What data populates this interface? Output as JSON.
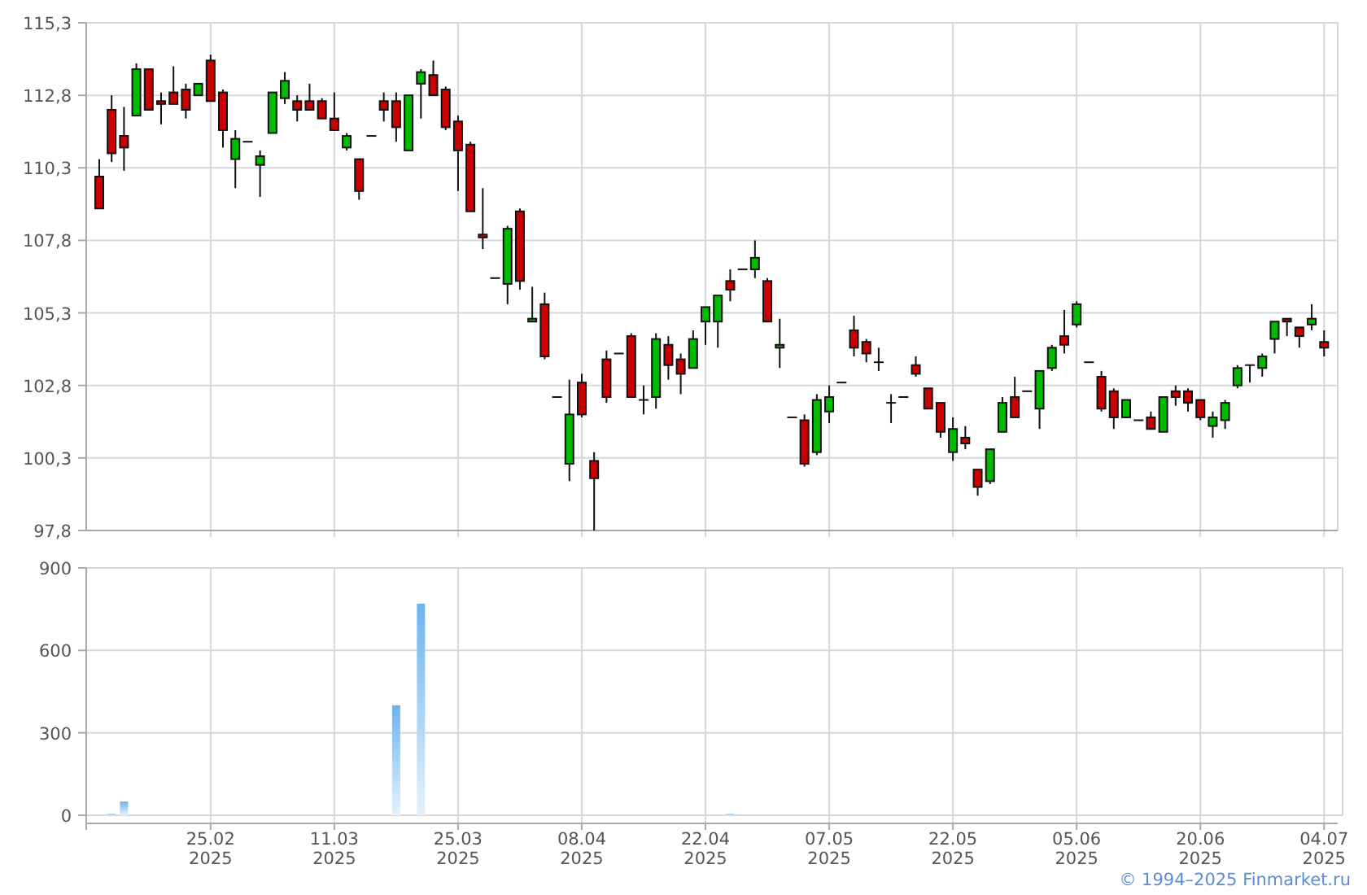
{
  "price_chart": {
    "chart_data": {
      "type": "candlestick",
      "ylim": [
        97.8,
        115.3
      ],
      "grid": true,
      "categories": [
        null,
        null,
        null,
        null,
        null,
        null,
        null,
        null,
        null,
        null,
        null,
        null,
        null,
        null,
        null,
        null,
        null,
        null,
        null,
        null,
        null,
        null,
        null,
        null,
        null,
        null,
        null,
        null,
        null,
        null,
        null,
        null,
        null,
        null,
        null,
        null,
        null,
        null,
        null,
        null,
        null,
        null,
        null,
        null,
        null,
        null,
        null,
        null,
        null,
        null,
        null,
        null,
        null,
        null,
        null,
        null,
        null,
        null,
        null,
        null,
        null,
        null,
        null,
        null,
        null,
        null,
        null,
        null,
        null,
        null,
        null,
        null,
        null,
        null,
        null,
        null,
        null,
        null,
        null,
        null,
        null,
        null,
        null,
        null,
        null,
        null,
        null,
        null,
        null,
        null,
        null,
        null,
        null,
        null,
        null,
        null,
        null,
        null,
        null,
        null
      ],
      "yticks": [
        {
          "value": 97.8,
          "label": "97,8"
        },
        {
          "value": 100.3,
          "label": "100,3"
        },
        {
          "value": 102.8,
          "label": "102,8"
        },
        {
          "value": 105.3,
          "label": "105,3"
        },
        {
          "value": 107.8,
          "label": "107,8"
        },
        {
          "value": 110.3,
          "label": "110,3"
        },
        {
          "value": 112.8,
          "label": "112,8"
        },
        {
          "value": 115.3,
          "label": "115,3"
        }
      ],
      "ohlc": [
        [
          110.0,
          110.6,
          108.9,
          108.9
        ],
        [
          112.3,
          112.8,
          110.5,
          110.8
        ],
        [
          111.4,
          112.4,
          110.2,
          111.0
        ],
        [
          112.1,
          113.9,
          112.1,
          113.7
        ],
        [
          113.7,
          113.7,
          112.3,
          112.3
        ],
        [
          112.6,
          112.9,
          111.8,
          112.5
        ],
        [
          112.9,
          113.8,
          112.5,
          112.5
        ],
        [
          113.0,
          113.2,
          112.0,
          112.3
        ],
        [
          112.8,
          113.2,
          112.8,
          113.2
        ],
        [
          114.0,
          114.2,
          112.6,
          112.6
        ],
        [
          112.9,
          113.0,
          111.0,
          111.6
        ],
        [
          110.6,
          111.6,
          109.6,
          111.3
        ],
        [
          111.2,
          111.2,
          111.2,
          111.2
        ],
        [
          110.4,
          110.9,
          109.3,
          110.7
        ],
        [
          111.5,
          112.9,
          111.5,
          112.9
        ],
        [
          112.7,
          113.6,
          112.5,
          113.3
        ],
        [
          112.6,
          112.8,
          111.9,
          112.3
        ],
        [
          112.6,
          113.2,
          112.3,
          112.3
        ],
        [
          112.6,
          112.7,
          112.0,
          112.0
        ],
        [
          112.0,
          112.9,
          111.6,
          111.6
        ],
        [
          111.0,
          111.5,
          110.9,
          111.4
        ],
        [
          110.6,
          110.6,
          109.2,
          109.5
        ],
        [
          111.4,
          111.4,
          111.4,
          111.4
        ],
        [
          112.6,
          112.9,
          111.9,
          112.3
        ],
        [
          112.6,
          112.9,
          111.2,
          111.7
        ],
        [
          110.9,
          112.8,
          110.9,
          112.8
        ],
        [
          113.2,
          113.7,
          112.0,
          113.6
        ],
        [
          113.5,
          114.0,
          112.8,
          112.8
        ],
        [
          113.0,
          113.1,
          111.6,
          111.7
        ],
        [
          111.9,
          112.1,
          109.5,
          110.9
        ],
        [
          111.1,
          111.2,
          108.8,
          108.8
        ],
        [
          108.0,
          109.6,
          107.5,
          107.9
        ],
        [
          106.5,
          106.5,
          106.5,
          106.5
        ],
        [
          106.3,
          108.3,
          105.6,
          108.2
        ],
        [
          108.8,
          108.9,
          106.1,
          106.4
        ],
        [
          105.0,
          106.2,
          105.0,
          105.1
        ],
        [
          105.6,
          106.0,
          103.7,
          103.8
        ],
        [
          102.4,
          102.4,
          102.4,
          102.4
        ],
        [
          100.1,
          103.0,
          99.5,
          101.8
        ],
        [
          102.9,
          103.2,
          101.7,
          101.8
        ],
        [
          100.2,
          100.5,
          97.8,
          99.6
        ],
        [
          103.7,
          104.0,
          102.2,
          102.4
        ],
        [
          103.9,
          103.9,
          103.9,
          103.9
        ],
        [
          104.5,
          104.6,
          102.4,
          102.4
        ],
        [
          102.3,
          102.8,
          101.8,
          102.3
        ],
        [
          102.4,
          104.6,
          102.0,
          104.4
        ],
        [
          104.2,
          104.5,
          103.0,
          103.5
        ],
        [
          103.7,
          103.9,
          102.5,
          103.2
        ],
        [
          103.4,
          104.7,
          103.4,
          104.4
        ],
        [
          105.0,
          105.5,
          104.2,
          105.5
        ],
        [
          105.0,
          105.9,
          104.1,
          105.9
        ],
        [
          106.4,
          106.8,
          105.7,
          106.1
        ],
        [
          106.8,
          106.8,
          106.8,
          106.8
        ],
        [
          106.8,
          107.8,
          106.5,
          107.2
        ],
        [
          106.4,
          106.5,
          105.0,
          105.0
        ],
        [
          104.1,
          105.1,
          103.4,
          104.2
        ],
        [
          101.7,
          101.7,
          101.7,
          101.7
        ],
        [
          101.6,
          101.8,
          100.0,
          100.1
        ],
        [
          100.5,
          102.5,
          100.4,
          102.3
        ],
        [
          101.9,
          102.8,
          101.5,
          102.4
        ],
        [
          102.9,
          102.9,
          102.9,
          102.9
        ],
        [
          104.7,
          105.2,
          103.8,
          104.1
        ],
        [
          104.3,
          104.4,
          103.6,
          103.9
        ],
        [
          103.6,
          104.1,
          103.3,
          103.6
        ],
        [
          102.2,
          102.5,
          101.5,
          102.2
        ],
        [
          102.4,
          102.4,
          102.4,
          102.4
        ],
        [
          103.5,
          103.8,
          103.1,
          103.2
        ],
        [
          102.7,
          102.7,
          102.0,
          102.0
        ],
        [
          102.2,
          102.2,
          101.0,
          101.2
        ],
        [
          100.5,
          101.7,
          100.2,
          101.3
        ],
        [
          101.0,
          101.4,
          100.6,
          100.8
        ],
        [
          99.9,
          99.9,
          99.0,
          99.3
        ],
        [
          99.5,
          100.6,
          99.4,
          100.6
        ],
        [
          101.2,
          102.4,
          101.2,
          102.2
        ],
        [
          102.4,
          103.1,
          101.7,
          101.7
        ],
        [
          102.6,
          102.6,
          102.6,
          102.6
        ],
        [
          102.0,
          103.3,
          101.3,
          103.3
        ],
        [
          103.4,
          104.2,
          103.3,
          104.1
        ],
        [
          104.5,
          105.4,
          103.9,
          104.2
        ],
        [
          104.9,
          105.7,
          104.8,
          105.6
        ],
        [
          103.6,
          103.6,
          103.6,
          103.6
        ],
        [
          103.1,
          103.3,
          101.9,
          102.0
        ],
        [
          102.6,
          102.7,
          101.3,
          101.7
        ],
        [
          101.7,
          102.3,
          101.7,
          102.3
        ],
        [
          101.6,
          101.6,
          101.6,
          101.6
        ],
        [
          101.7,
          101.9,
          101.3,
          101.3
        ],
        [
          101.2,
          102.4,
          101.2,
          102.4
        ],
        [
          102.6,
          102.8,
          102.1,
          102.4
        ],
        [
          102.6,
          102.7,
          101.9,
          102.2
        ],
        [
          102.3,
          102.3,
          101.6,
          101.7
        ],
        [
          101.4,
          101.9,
          101.0,
          101.7
        ],
        [
          101.6,
          102.3,
          101.3,
          102.2
        ],
        [
          102.8,
          103.5,
          102.7,
          103.4
        ],
        [
          103.5,
          103.5,
          102.9,
          103.5
        ],
        [
          103.4,
          103.9,
          103.1,
          103.8
        ],
        [
          104.4,
          105.0,
          103.9,
          105.0
        ],
        [
          105.1,
          105.1,
          104.5,
          105.0
        ],
        [
          104.8,
          104.8,
          104.1,
          104.5
        ],
        [
          104.9,
          105.6,
          104.7,
          105.1
        ],
        [
          104.3,
          104.7,
          103.8,
          104.1
        ]
      ]
    }
  },
  "volume_chart": {
    "chart_data": {
      "type": "bar",
      "ylim": [
        0,
        900
      ],
      "grid": true,
      "categories": [
        null,
        null,
        null,
        null,
        null,
        null,
        null,
        null,
        null,
        "25.02\n2025",
        null,
        null,
        null,
        null,
        null,
        null,
        null,
        null,
        null,
        "11.03\n2025",
        null,
        null,
        null,
        null,
        null,
        null,
        null,
        null,
        null,
        "25.03\n2025",
        null,
        null,
        null,
        null,
        null,
        null,
        null,
        null,
        null,
        "08.04\n2025",
        null,
        null,
        null,
        null,
        null,
        null,
        null,
        null,
        null,
        "22.04\n2025",
        null,
        null,
        null,
        null,
        null,
        null,
        null,
        null,
        null,
        "07.05\n2025",
        null,
        null,
        null,
        null,
        null,
        null,
        null,
        null,
        null,
        "22.05\n2025",
        null,
        null,
        null,
        null,
        null,
        null,
        null,
        null,
        null,
        "05.06\n2025",
        null,
        null,
        null,
        null,
        null,
        null,
        null,
        null,
        null,
        "20.06\n2025",
        null,
        null,
        null,
        null,
        null,
        null,
        null,
        null,
        null,
        "04.07\n2025"
      ],
      "yticks": [
        0,
        300,
        600,
        900
      ],
      "values": [
        0,
        5,
        50,
        0,
        0,
        0,
        0,
        0,
        0,
        0,
        0,
        0,
        0,
        0,
        0,
        0,
        0,
        0,
        0,
        0,
        0,
        0,
        0,
        0,
        400,
        0,
        770,
        0,
        0,
        0,
        0,
        0,
        0,
        0,
        0,
        0,
        0,
        0,
        0,
        0,
        0,
        0,
        0,
        0,
        0,
        0,
        0,
        0,
        0,
        0,
        0,
        5,
        0,
        0,
        0,
        0,
        0,
        0,
        0,
        0,
        0,
        0,
        0,
        0,
        0,
        0,
        0,
        0,
        0,
        0,
        0,
        0,
        0,
        0,
        0,
        0,
        0,
        0,
        0,
        0,
        0,
        0,
        0,
        0,
        0,
        0,
        0,
        0,
        0,
        0,
        0,
        0,
        0,
        0,
        0,
        0,
        0,
        0,
        0,
        0
      ]
    }
  },
  "footer": {
    "copyright": "© 1994–2025 Finmarket.ru"
  }
}
